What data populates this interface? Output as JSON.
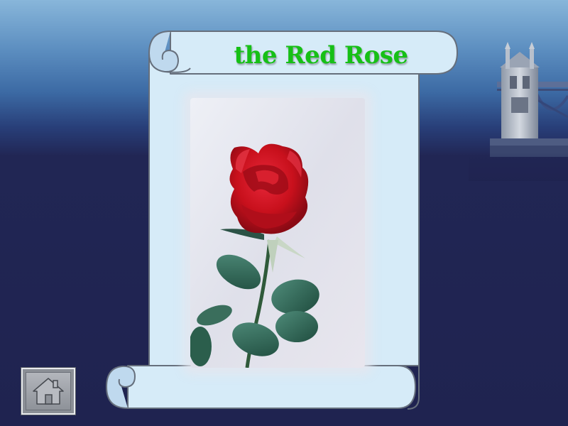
{
  "slide": {
    "title": "the Red Rose"
  },
  "navigation": {
    "home_icon": "home-icon"
  },
  "colors": {
    "title": "#16c016",
    "scroll_fill": "#d6ebf8",
    "scroll_stroke": "#666f7c",
    "background_top": "#88b6da",
    "background_bottom": "#1f2350",
    "rose": "#c8101c"
  }
}
